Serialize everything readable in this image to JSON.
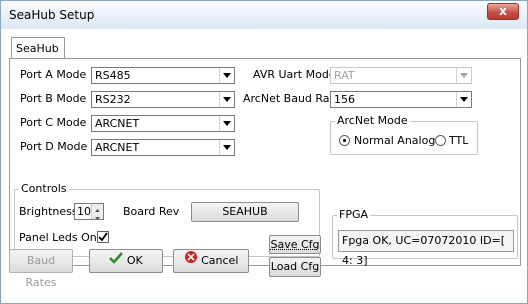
{
  "window": {
    "title": "SeaHub Setup",
    "close_glyph": "x"
  },
  "tabs": [
    {
      "label": "SeaHub"
    }
  ],
  "ports": {
    "a": {
      "label": "Port A Mode",
      "value": "RS485"
    },
    "b": {
      "label": "Port B Mode",
      "value": "RS232"
    },
    "c": {
      "label": "Port C Mode",
      "value": "ARCNET"
    },
    "d": {
      "label": "Port D Mode",
      "value": "ARCNET"
    }
  },
  "avr_uart": {
    "label": "AVR Uart Mode",
    "value": "RAT"
  },
  "arcnet_baud": {
    "label": "ArcNet Baud Rate",
    "value": "156"
  },
  "arcnet_mode": {
    "title": "ArcNet Mode",
    "options": [
      {
        "label": "Normal Analog",
        "selected": true
      },
      {
        "label": "TTL",
        "selected": false
      }
    ]
  },
  "controls": {
    "title": "Controls",
    "brightness_label": "Brightness",
    "brightness_value": "10",
    "board_rev_label": "Board Rev",
    "board_rev_value": "SEAHUB",
    "panel_leds_label": "Panel Leds On",
    "panel_leds_checked": true
  },
  "fpga": {
    "title": "FPGA",
    "status": "Fpga OK, UC=07072010 ID=[ 4: 3]"
  },
  "buttons": {
    "baud_rates": "Baud Rates",
    "ok": "OK",
    "cancel": "Cancel",
    "save_cfg": "Save Cfg",
    "load_cfg": "Load Cfg"
  },
  "colors": {
    "accent_check": "#2e8b2e",
    "cancel_icon": "#cc2222",
    "close_button": "#c75050"
  }
}
